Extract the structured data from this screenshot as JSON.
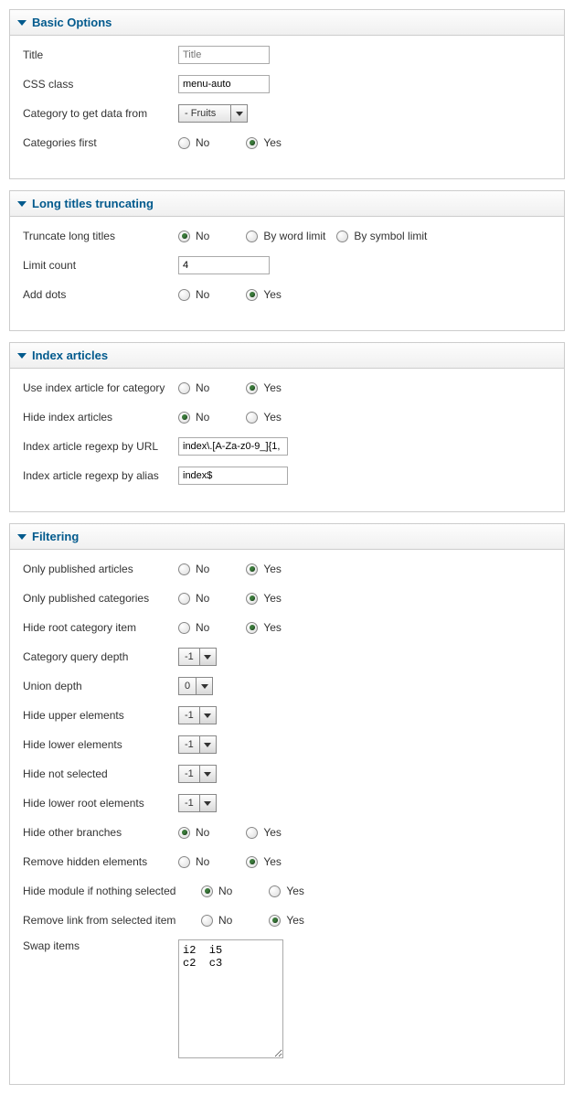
{
  "labels": {
    "no": "No",
    "yes": "Yes"
  },
  "sections": {
    "basic": {
      "title": "Basic Options",
      "title_field": {
        "label": "Title",
        "placeholder": "Title",
        "value": ""
      },
      "css_class": {
        "label": "CSS class",
        "value": "menu-auto"
      },
      "category_source": {
        "label": "Category to get data from",
        "value": " - Fruits"
      },
      "categories_first": {
        "label": "Categories first",
        "value": "yes"
      }
    },
    "truncate": {
      "title": "Long titles truncating",
      "truncate_titles": {
        "label": "Truncate long titles",
        "options": [
          "No",
          "By word limit",
          "By symbol limit"
        ],
        "value": "No"
      },
      "limit_count": {
        "label": "Limit count",
        "value": "4"
      },
      "add_dots": {
        "label": "Add dots",
        "value": "yes"
      }
    },
    "index": {
      "title": "Index articles",
      "use_index": {
        "label": "Use index article for category",
        "value": "yes"
      },
      "hide_index": {
        "label": "Hide index articles",
        "value": "no"
      },
      "regexp_url": {
        "label": "Index article regexp by URL",
        "value": "index\\.[A-Za-z0-9_]{1,"
      },
      "regexp_alias": {
        "label": "Index article regexp by alias",
        "value": "index$"
      }
    },
    "filtering": {
      "title": "Filtering",
      "only_pub_articles": {
        "label": "Only published articles",
        "value": "yes"
      },
      "only_pub_categories": {
        "label": "Only published categories",
        "value": "yes"
      },
      "hide_root": {
        "label": "Hide root category item",
        "value": "yes"
      },
      "category_depth": {
        "label": "Category query depth",
        "value": "-1"
      },
      "union_depth": {
        "label": "Union depth",
        "value": "0"
      },
      "hide_upper": {
        "label": "Hide upper elements",
        "value": "-1"
      },
      "hide_lower": {
        "label": "Hide lower elements",
        "value": "-1"
      },
      "hide_not_selected": {
        "label": "Hide not selected",
        "value": "-1"
      },
      "hide_lower_root": {
        "label": "Hide lower root elements",
        "value": "-1"
      },
      "hide_other_branches": {
        "label": "Hide other branches",
        "value": "no"
      },
      "remove_hidden": {
        "label": "Remove hidden elements",
        "value": "yes"
      },
      "hide_module": {
        "label": "Hide module if nothing selected",
        "value": "no"
      },
      "remove_link": {
        "label": "Remove link from selected item",
        "value": "yes"
      },
      "swap_items": {
        "label": "Swap items",
        "value": "i2  i5\nc2  c3"
      }
    }
  }
}
